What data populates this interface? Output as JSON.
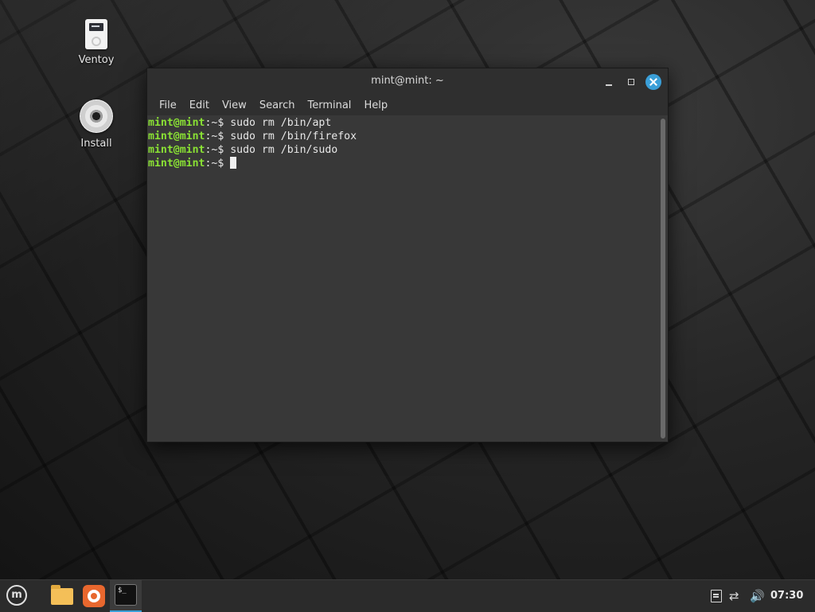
{
  "desktop": {
    "icons": [
      {
        "label": "Ventoy",
        "icon": "usb-drive-icon"
      },
      {
        "label": "Install",
        "icon": "cd-disc-icon"
      }
    ]
  },
  "terminal": {
    "title": "mint@mint: ~",
    "menu": [
      "File",
      "Edit",
      "View",
      "Search",
      "Terminal",
      "Help"
    ],
    "prompt_user": "mint@mint",
    "prompt_path": ":~$ ",
    "lines": [
      {
        "command": "sudo rm /bin/apt"
      },
      {
        "command": "sudo rm /bin/firefox"
      },
      {
        "command": "sudo rm /bin/sudo"
      },
      {
        "command": ""
      }
    ],
    "colors": {
      "prompt": "#8ae234",
      "background": "#383838",
      "close_button": "#3a9fd8"
    }
  },
  "taskbar": {
    "menu_icon": "linux-mint-logo-icon",
    "menu_logo_text": "m",
    "launchers": [
      "folder-icon",
      "firefox-icon",
      "terminal-icon"
    ],
    "terminal_icon_text": "$_",
    "tray": {
      "icons": [
        "clipboard-icon",
        "network-disconnected-icon",
        "volume-icon"
      ],
      "network_glyph": "⇄",
      "volume_glyph": "🔊",
      "clock": "07:30"
    }
  }
}
